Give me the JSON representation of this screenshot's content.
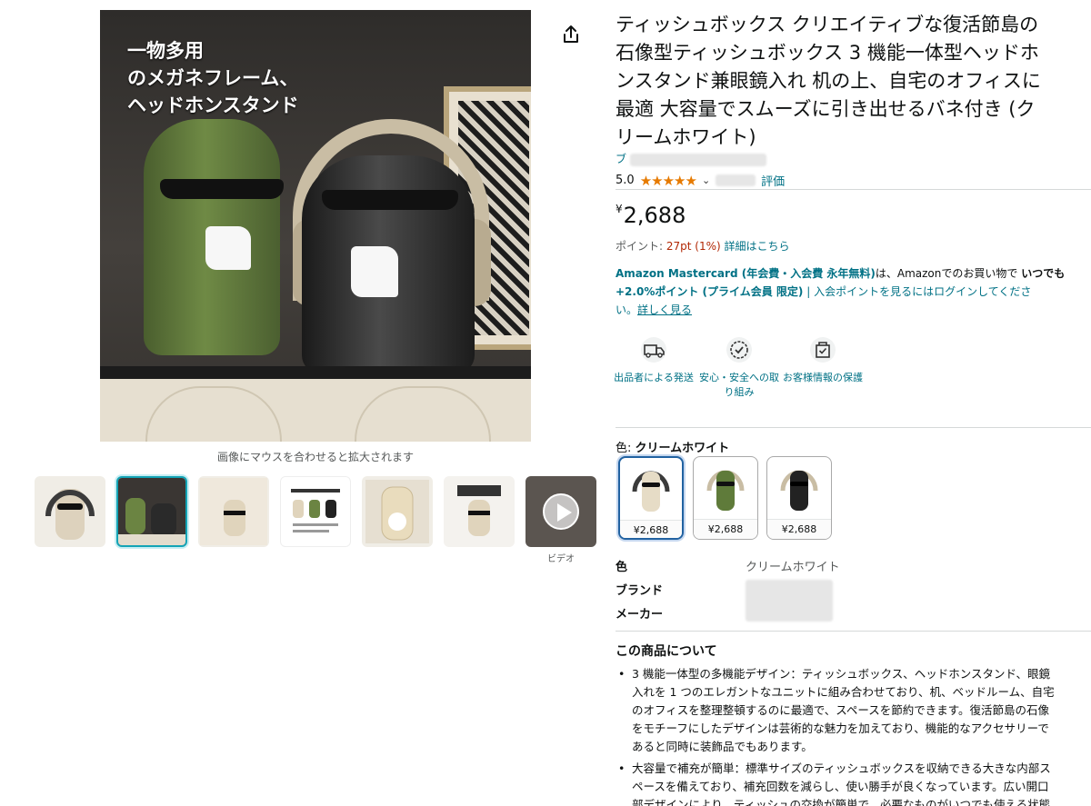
{
  "main_image": {
    "caption": "一物多用\nのメガネフレーム、\nヘッドホンスタンド",
    "zoom_hint": "画像にマウスを合わせると拡大されます"
  },
  "thumbnails": {
    "video_label": "ビデオ",
    "items": [
      {
        "name": "thumb-1"
      },
      {
        "name": "thumb-2"
      },
      {
        "name": "thumb-3"
      },
      {
        "name": "thumb-4"
      },
      {
        "name": "thumb-5"
      },
      {
        "name": "thumb-6"
      },
      {
        "name": "thumb-video"
      }
    ]
  },
  "product": {
    "title_lines": [
      "ティッシュボックス クリエイティブな復活節島の",
      "石像型ティッシュボックス 3 機能一体型ヘッドホ",
      "ンスタンド兼眼鏡入れ 机の上、自宅のオフィスに",
      "最適 大容量でスムーズに引き出せるバネ付き (ク",
      "リームホワイト)"
    ],
    "brand_prefix": "ブ",
    "rating_value": "5.0",
    "rating_stars": "★★★★★",
    "rating_count_suffix": "評価",
    "price_symbol": "¥",
    "price": "2,688",
    "points_label": "ポイント: ",
    "points_value": "27pt",
    "points_pct": "(1%)",
    "points_link": "詳細はこちら"
  },
  "card_offer": {
    "line1_bold": "Amazon Mastercard (年会費・入会費 永年無料)",
    "line1_text": "は、Amazonでのお買い物で ",
    "line1_tail": "いつでも",
    "line2_bold": "+2.0%ポイント (プライム会員 限定)",
    "line2_text": " | 入会ポイントを見るにはログインしてくださ",
    "line3_text": "い。",
    "line3_link": "詳しく見る"
  },
  "badges": [
    {
      "label": "出品者による発送",
      "icon": "truck-icon"
    },
    {
      "label": "安心・安全への取り組み",
      "icon": "shield-check-icon"
    },
    {
      "label": "お客様情報の保護",
      "icon": "secure-bag-icon"
    }
  ],
  "color": {
    "label": "色: ",
    "selected": "クリームホワイト",
    "options": [
      {
        "price": "¥2,688",
        "tone": "#e6dcc6"
      },
      {
        "price": "¥2,688",
        "tone": "#5f7b3a"
      },
      {
        "price": "¥2,688",
        "tone": "#222222"
      }
    ]
  },
  "specs": {
    "color_label": "色",
    "color_value": "クリームホワイト",
    "brand_label": "ブランド",
    "maker_label": "メーカー"
  },
  "about": {
    "heading": "この商品について",
    "bullets": [
      [
        "3 機能一体型の多機能デザイン：ティッシュボックス、ヘッドホンスタンド、眼鏡",
        "入れを 1 つのエレガントなユニットに組み合わせており、机、ベッドルーム、自宅",
        "のオフィスを整理整頓するのに最適で、スペースを節約できます。復活節島の石像",
        "をモチーフにしたデザインは芸術的な魅力を加えており、機能的なアクセサリーで",
        "あると同時に装飾品でもあります。"
      ],
      [
        "大容量で補充が簡単：標準サイズのティッシュボックスを収納できる大きな内部ス",
        "ペースを備えており、補充回数を減らし、使い勝手が良くなっています。広い開口",
        "部デザインにより、ティッシュの交換が簡単で、必要なものがいつでも使える状態"
      ]
    ]
  }
}
